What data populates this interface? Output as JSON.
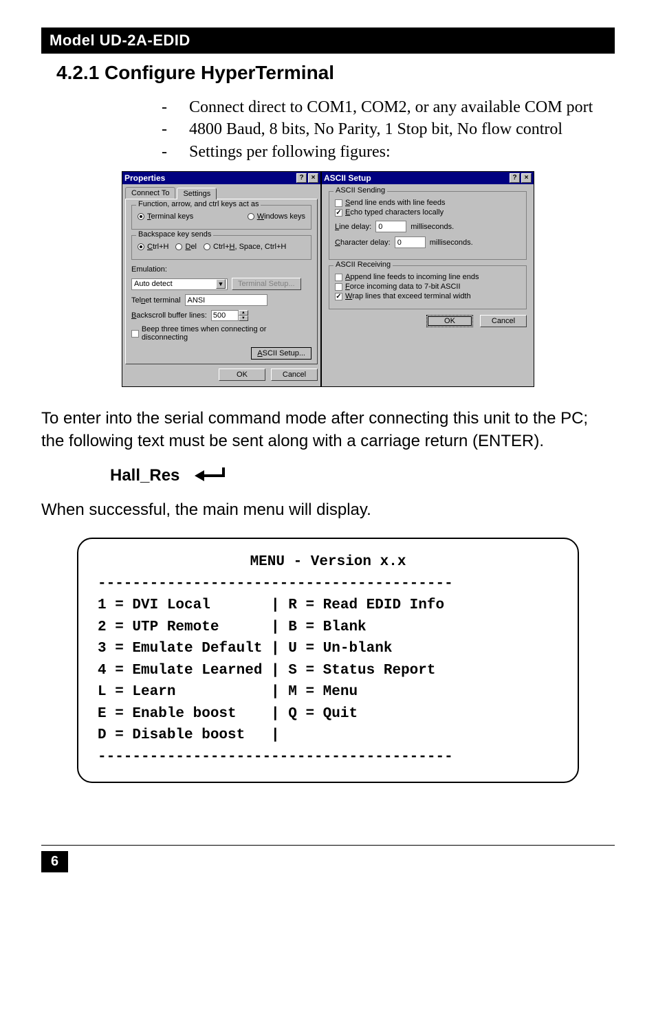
{
  "model_bar": "Model UD-2A-EDID",
  "section_title": "4.2.1 Configure HyperTerminal",
  "bullets": [
    "Connect direct to COM1, COM2, or any available COM port",
    "4800 Baud, 8 bits, No Parity, 1 Stop bit, No flow control",
    "Settings per following figures:"
  ],
  "props": {
    "title": "Properties",
    "tabs": {
      "connect": "Connect To",
      "settings": "Settings"
    },
    "grp_funckeys": {
      "legend": "Function, arrow, and ctrl keys act as",
      "opt_terminal": "Terminal keys",
      "opt_windows": "Windows keys"
    },
    "grp_backspace": {
      "legend": "Backspace key sends",
      "opt_ctrlh": "Ctrl+H",
      "opt_del": "Del",
      "opt_ctrlh_space": "Ctrl+H, Space, Ctrl+H"
    },
    "emulation_label": "Emulation:",
    "emulation_value": "Auto detect",
    "terminal_setup_btn": "Terminal Setup...",
    "telnet_label": "Telnet terminal",
    "telnet_value": "ANSI",
    "backscroll_label": "Backscroll buffer lines:",
    "backscroll_value": "500",
    "beep_label": "Beep three times when connecting or disconnecting",
    "ascii_setup_btn": "ASCII Setup...",
    "ok": "OK",
    "cancel": "Cancel"
  },
  "ascii": {
    "title": "ASCII Setup",
    "sending_legend": "ASCII Sending",
    "send_line_ends": "Send line ends with line feeds",
    "echo_local": "Echo typed characters locally",
    "line_delay_label": "Line delay:",
    "line_delay_value": "0",
    "char_delay_label": "Character delay:",
    "char_delay_value": "0",
    "ms": "milliseconds.",
    "receiving_legend": "ASCII Receiving",
    "append_feeds": "Append line feeds to incoming line ends",
    "force_7bit": "Force incoming data to 7-bit ASCII",
    "wrap_lines": "Wrap lines that exceed terminal width",
    "ok": "OK",
    "cancel": "Cancel"
  },
  "serial_text": "To enter into the serial command mode after connecting this unit to the PC; the following text must be sent along with a carriage return (ENTER).",
  "hall_res": "Hall_Res",
  "success_text": "When successful, the main menu will display.",
  "menu": {
    "title": "MENU - Version x.x",
    "sep": "-----------------------------------------",
    "lines": [
      "1 = DVI Local       | R = Read EDID Info",
      "2 = UTP Remote      | B = Blank",
      "3 = Emulate Default | U = Un-blank",
      "4 = Emulate Learned | S = Status Report",
      "L = Learn           | M = Menu",
      "E = Enable boost    | Q = Quit",
      "D = Disable boost   |"
    ]
  },
  "page_number": "6"
}
